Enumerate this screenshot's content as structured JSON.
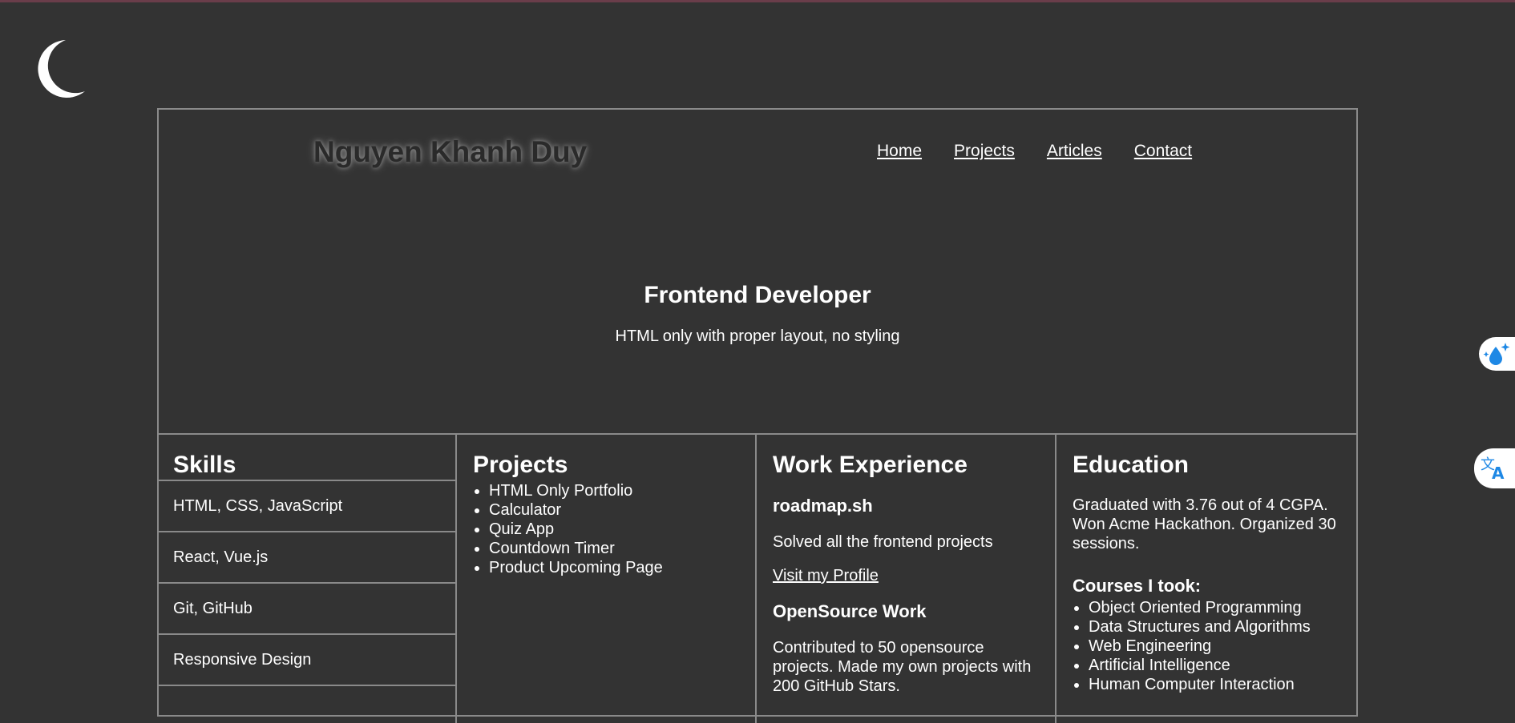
{
  "header": {
    "site_name": "Nguyen Khanh Duy",
    "nav": [
      "Home",
      "Projects",
      "Articles",
      "Contact"
    ]
  },
  "hero": {
    "title": "Frontend Developer",
    "subtitle": "HTML only with proper layout, no styling"
  },
  "skills": {
    "heading": "Skills",
    "items": [
      "HTML, CSS, JavaScript",
      "React, Vue.js",
      "Git, GitHub",
      "Responsive Design"
    ]
  },
  "projects": {
    "heading": "Projects",
    "items": [
      "HTML Only Portfolio",
      "Calculator",
      "Quiz App",
      "Countdown Timer",
      "Product Upcoming Page"
    ]
  },
  "work": {
    "heading": "Work Experience",
    "company": "roadmap.sh",
    "company_desc": "Solved all the frontend projects",
    "profile_link": "Visit my Profile",
    "opensource_title": "OpenSource Work",
    "opensource_desc": "Contributed to 50 opensource projects. Made my own projects with 200 GitHub Stars."
  },
  "education": {
    "heading": "Education",
    "summary": "Graduated with 3.76 out of 4 CGPA. Won Acme Hackathon. Organized 30 sessions.",
    "courses_title": "Courses I took:",
    "courses": [
      "Object Oriented Programming",
      "Data Structures and Algorithms",
      "Web Engineering",
      "Artificial Intelligence",
      "Human Computer Interaction"
    ]
  },
  "icons": {
    "theme_toggle": "moon-icon",
    "side_one": "water-drop-sparkle-icon",
    "side_two": "translate-icon"
  },
  "colors": {
    "background": "#333333",
    "border": "#8a8a8a",
    "accent_blue": "#1e88e5"
  }
}
